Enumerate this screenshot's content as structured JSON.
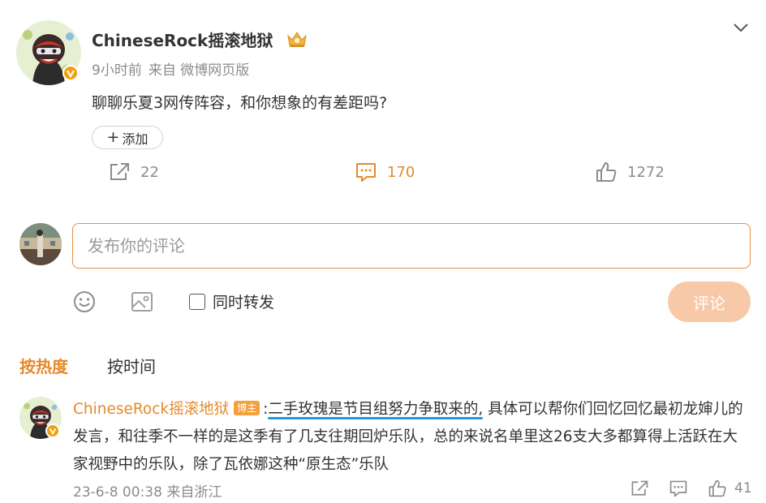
{
  "post": {
    "author": "ChineseRock摇滚地狱",
    "time": "9小时前",
    "source": "来自 微博网页版",
    "text": "聊聊乐夏3网传阵容，和你想象的有差距吗?",
    "add_tag_label": "添加",
    "add_tag_plus": "+",
    "stats": {
      "shares": "22",
      "comments": "170",
      "likes": "1272"
    }
  },
  "composer": {
    "placeholder": "发布你的评论",
    "repost_label": "同时转发",
    "submit_label": "评论"
  },
  "sort_tabs": {
    "hot": "按热度",
    "time": "按时间"
  },
  "comment": {
    "author": "ChineseRock摇滚地狱",
    "badge": "博主",
    "colon": ":",
    "highlight": "二手玫瑰是节目组努力争取来的,",
    "rest": " 具体可以帮你们回忆回忆最初龙婶儿的发言，和往季不一样的是这季有了几支往期回炉乐队，总的来说名单里这26支大多都算得上活跃在大家视野中的乐队，除了瓦依娜这种“原生态”乐队",
    "date": "23-6-8 00:38",
    "location": "来自浙江",
    "likes": "41"
  },
  "colors": {
    "accent": "#e5892a",
    "highlight_underline": "#1a9be8",
    "submit_bg": "#f8c9a8",
    "verify": "#f0a10c"
  },
  "icons": [
    "chevron-down-icon",
    "share-icon",
    "comment-icon",
    "like-icon",
    "emoji-icon",
    "image-icon",
    "crown-icon",
    "verified-icon"
  ]
}
